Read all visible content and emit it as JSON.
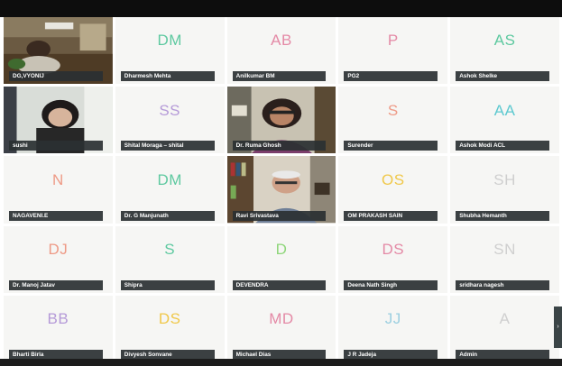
{
  "participants": [
    {
      "name": "DG,VYONIJ",
      "video": true,
      "scene": "office"
    },
    {
      "name": "Dharmesh Mehta",
      "initials": "DM",
      "color": "#5ec9a0"
    },
    {
      "name": "Anilkumar BM",
      "initials": "AB",
      "color": "#e48aa6"
    },
    {
      "name": "PG2",
      "initials": "P",
      "color": "#e48aa6"
    },
    {
      "name": "Ashok Shelke",
      "initials": "AS",
      "color": "#5ec9a0"
    },
    {
      "name": "sushi",
      "video": true,
      "scene": "woman-desk"
    },
    {
      "name": "Shital Moraga – shital",
      "initials": "SS",
      "color": "#b59ad8"
    },
    {
      "name": "Dr. Ruma Ghosh",
      "video": true,
      "scene": "woman-room"
    },
    {
      "name": "Surender",
      "initials": "S",
      "color": "#ee9a86"
    },
    {
      "name": "Ashok Modi ACL",
      "initials": "AA",
      "color": "#5ec9d0"
    },
    {
      "name": "NAGAVENI.E",
      "initials": "N",
      "color": "#ee9a86"
    },
    {
      "name": "Dr. G Manjunath",
      "initials": "DM",
      "color": "#5ec9a0"
    },
    {
      "name": "Ravi Srivastava",
      "video": true,
      "scene": "man-bookshelf"
    },
    {
      "name": "OM PRAKASH SAIN",
      "initials": "OS",
      "color": "#f0c84a"
    },
    {
      "name": "Shubha Hemanth",
      "initials": "SH",
      "color": "#cfcfcf"
    },
    {
      "name": "Dr. Manoj Jatav",
      "initials": "DJ",
      "color": "#ee9a86"
    },
    {
      "name": "Shipra",
      "initials": "S",
      "color": "#5ec9a0"
    },
    {
      "name": "DEVENDRA",
      "initials": "D",
      "color": "#8ed67a"
    },
    {
      "name": "Deena Nath Singh",
      "initials": "DS",
      "color": "#e48aa6"
    },
    {
      "name": "sridhara nagesh",
      "initials": "SN",
      "color": "#cfcfcf"
    },
    {
      "name": "Bharti Birla",
      "initials": "BB",
      "color": "#b59ad8"
    },
    {
      "name": "Divyesh Sonvane",
      "initials": "DS",
      "color": "#f0c84a"
    },
    {
      "name": "Michael Dias",
      "initials": "MD",
      "color": "#e48aa6"
    },
    {
      "name": "J R Jadeja",
      "initials": "JJ",
      "color": "#9ccfe0"
    },
    {
      "name": "Admin",
      "initials": "A",
      "color": "#cfcfcf"
    }
  ]
}
